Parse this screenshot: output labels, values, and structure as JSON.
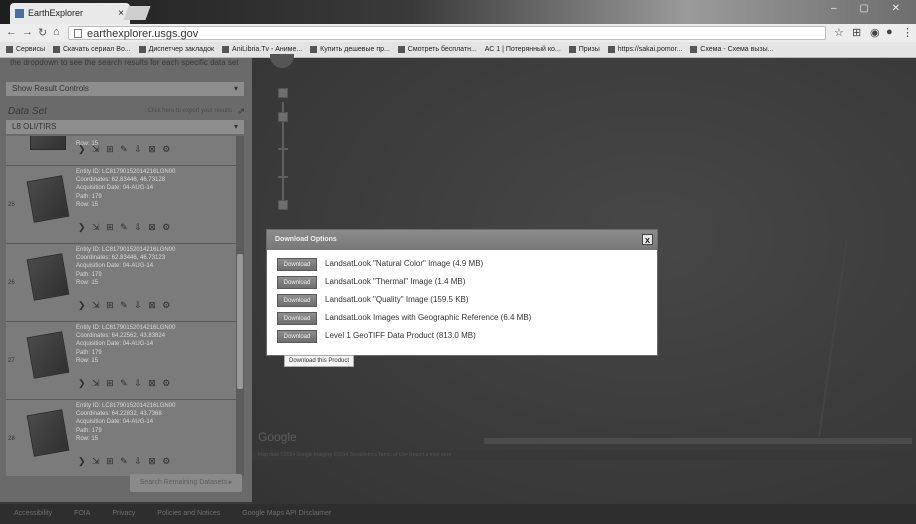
{
  "browser": {
    "tab_title": "EarthExplorer",
    "tab_close": "×",
    "window_controls": "–  ▢  ✕",
    "url": "earthexplorer.usgs.gov",
    "bookmarks": [
      "Сервисы",
      "Скачать сериал Во...",
      "Диспетчер закладок",
      "AniLibria.Tv - Аниме...",
      "Купить дешевые пр...",
      "Смотреть бесплатн...",
      "АС 1 | Потерянный ко...",
      "Призы",
      "https://sakai.pomor...",
      "Схема - Схема вызы..."
    ]
  },
  "left_panel": {
    "hint_text": "the dropdown to see the search results for each specific data set",
    "show_result_controls": "Show Result Controls",
    "data_set_label": "Data Set",
    "data_set_link": "Click here to export your results",
    "data_set_value": "L8 OLI/TIRS",
    "show_more_button": "Search Remaining Datasets ▸",
    "records": [
      {
        "index": "",
        "row_label": "Row: 15",
        "entity": "",
        "coords": "",
        "date": "",
        "path": ""
      },
      {
        "index": "25",
        "entity": "Entity ID: LC81790152014216LGN00",
        "coords": "Coordinates: 62.83446, 46.73128",
        "date": "Acquisition Date: 04-AUG-14",
        "path": "Path: 179",
        "row_label": "Row: 15"
      },
      {
        "index": "26",
        "entity": "Entity ID: LC81790152014216LGN00",
        "coords": "Coordinates: 62.83446, 46.73123",
        "date": "Acquisition Date: 04-AUG-14",
        "path": "Path: 179",
        "row_label": "Row: 15"
      },
      {
        "index": "27",
        "entity": "Entity ID: LC81790152014216LGN00",
        "coords": "Coordinates: 64.22562, 43.83824",
        "date": "Acquisition Date: 04-AUG-14",
        "path": "Path: 179",
        "row_label": "Row: 15"
      },
      {
        "index": "28",
        "entity": "Entity ID: LC81790152014216LGN00",
        "coords": "Coordinates: 64.22832, 43.7368",
        "date": "Acquisition Date: 04-AUG-14",
        "path": "Path: 179",
        "row_label": "Row: 15"
      }
    ],
    "action_icons": "❯ ⇲ ⊞ ✎ ⇩ ⊠ ⚙"
  },
  "map": {
    "google_logo": "Google",
    "copyright": "Map data ©2014 Google  Imagery ©2014 TerraMetrics  Terms of Use  Report a map error"
  },
  "dialog": {
    "title": "Download Options",
    "close": "x",
    "options": [
      {
        "button": "Download",
        "label": "LandsatLook \"Natural Color\" Image (4.9 MB)"
      },
      {
        "button": "Download",
        "label": "LandsatLook \"Thermal\" Image (1.4 MB)"
      },
      {
        "button": "Download",
        "label": "LandsatLook \"Quality\" Image (159.5 KB)"
      },
      {
        "button": "Download",
        "label": "LandsatLook Images with Geographic Reference (6.4 MB)"
      },
      {
        "button": "Download",
        "label": "Level 1 GeoTIFF Data Product (813.0 MB)"
      }
    ],
    "tooltip": "Download this Product"
  },
  "footer": {
    "links": [
      "Accessibility",
      "FOIA",
      "Privacy",
      "Policies and Notices",
      "Google Maps API Disclaimer"
    ]
  }
}
